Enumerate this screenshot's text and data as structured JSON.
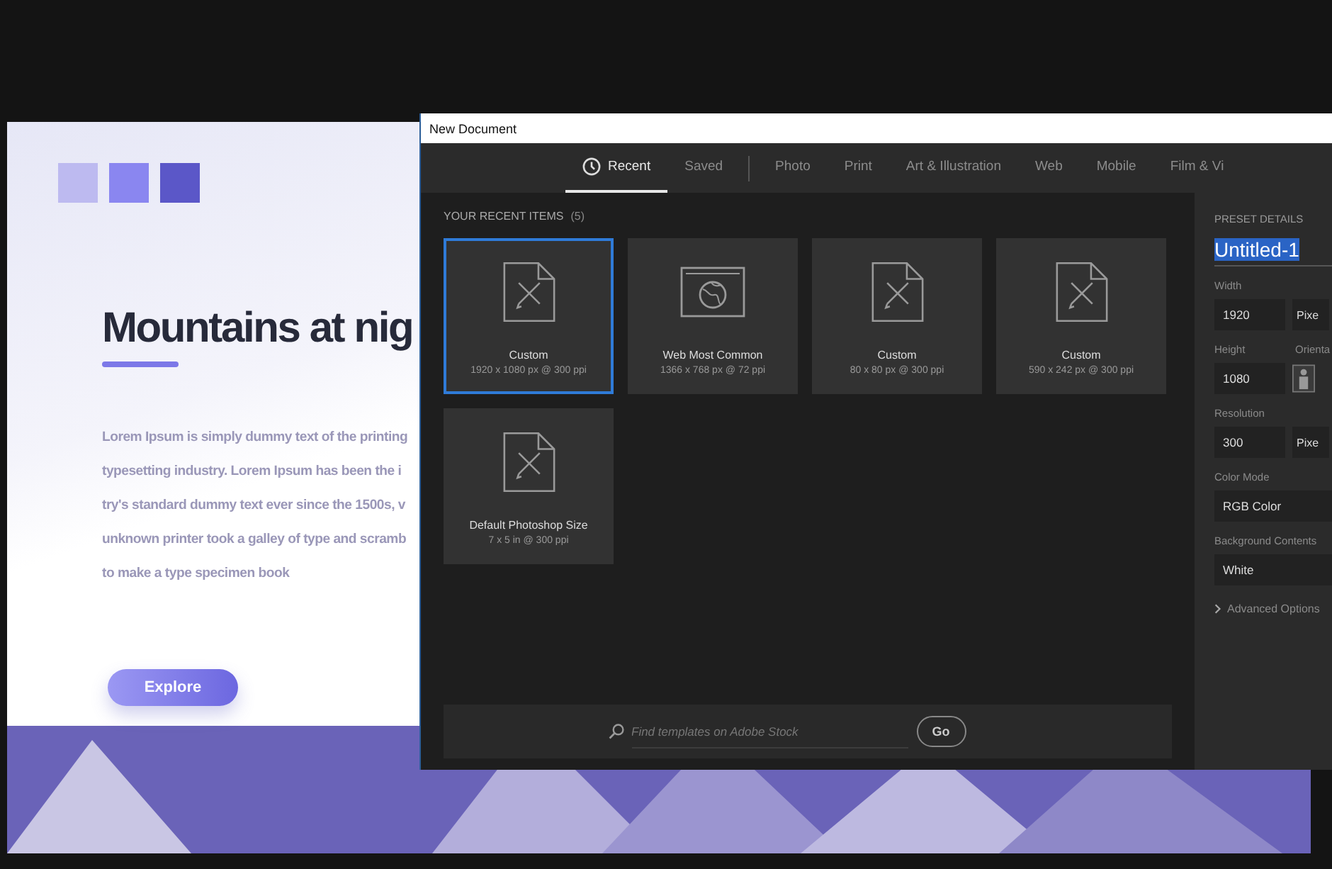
{
  "mockup": {
    "title": "Mountains at nig",
    "body_lines": [
      "Lorem Ipsum is simply dummy text of the printing",
      "typesetting industry. Lorem Ipsum has been the i",
      "try's standard dummy text ever since the 1500s, v",
      "unknown printer took a galley of type and scramb",
      "to make a type specimen book"
    ],
    "button": "Explore"
  },
  "window": {
    "title": "New Document"
  },
  "tab_groups": [
    [
      {
        "label": "Recent",
        "selected": true,
        "kind": "clock"
      },
      {
        "label": "Saved",
        "selected": false,
        "kind": "plain"
      }
    ],
    [
      {
        "label": "Photo",
        "selected": false,
        "kind": "plain"
      },
      {
        "label": "Print",
        "selected": false,
        "kind": "plain"
      },
      {
        "label": "Art & Illustration",
        "selected": false,
        "kind": "plain"
      },
      {
        "label": "Web",
        "selected": false,
        "kind": "plain"
      },
      {
        "label": "Mobile",
        "selected": false,
        "kind": "plain"
      },
      {
        "label": "Film & Vi",
        "selected": false,
        "kind": "plain"
      }
    ]
  ],
  "recent": {
    "heading": "YOUR RECENT ITEMS",
    "count": "(5)",
    "items": [
      {
        "name": "Custom",
        "size": "1920 x 1080 px @ 300 ppi",
        "kind": "document",
        "selected": true
      },
      {
        "name": "Web Most Common",
        "size": "1366 x 768 px @ 72 ppi",
        "kind": "web",
        "selected": false
      },
      {
        "name": "Custom",
        "size": "80 x 80 px @ 300 ppi",
        "kind": "document",
        "selected": false
      },
      {
        "name": "Custom",
        "size": "590 x 242 px @ 300 ppi",
        "kind": "document",
        "selected": false
      },
      {
        "name": "Default Photoshop Size",
        "size": "7 x 5 in @ 300 ppi",
        "kind": "document",
        "selected": false
      }
    ]
  },
  "search": {
    "placeholder": "Find templates on Adobe Stock",
    "button": "Go"
  },
  "preset": {
    "heading": "PRESET DETAILS",
    "name": "Untitled-1",
    "name_selected": true,
    "width": {
      "label": "Width",
      "value": "1920",
      "unit": "Pixe"
    },
    "height": {
      "label": "Height",
      "value": "1080"
    },
    "orientation": {
      "label": "Orienta"
    },
    "resolution": {
      "label": "Resolution",
      "value": "300",
      "unit": "Pixe"
    },
    "color_mode": {
      "label": "Color Mode",
      "value": "RGB Color"
    },
    "background": {
      "label": "Background Contents",
      "value": "White"
    },
    "advanced": "Advanced Options"
  }
}
